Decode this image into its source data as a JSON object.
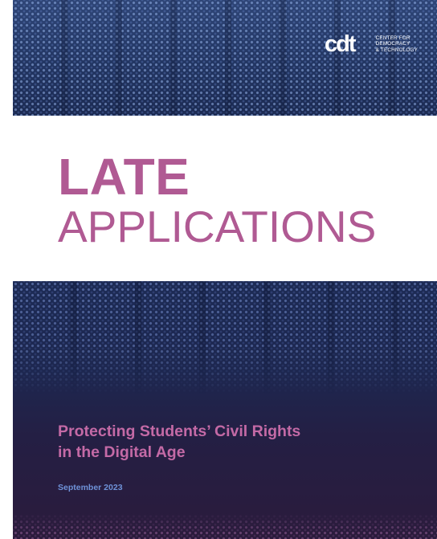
{
  "logo": {
    "mark": "cdt",
    "lines": [
      "CENTER FOR",
      "DEMOCRACY",
      "& TECHNOLOGY"
    ]
  },
  "title": {
    "line1": "LATE",
    "line2": "APPLICATIONS"
  },
  "subtitle": {
    "line1": "Protecting Students’ Civil Rights",
    "line2": "in the Digital Age"
  },
  "date": "September 2023",
  "colors": {
    "title": "#b05a93",
    "subtitle": "#c46aa6",
    "date": "#6f92d8",
    "navy": "#1c2a54"
  }
}
